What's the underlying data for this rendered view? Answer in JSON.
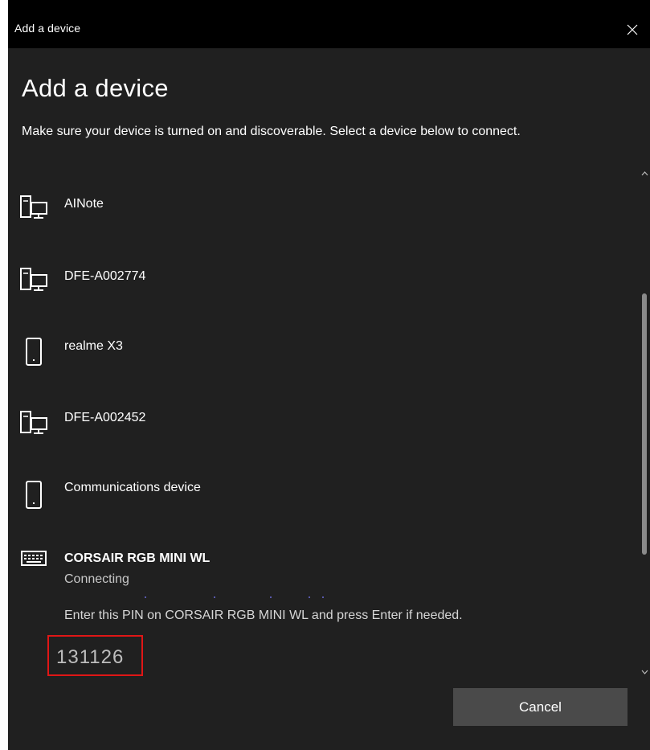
{
  "window": {
    "title": "Add a device",
    "heading": "Add a device",
    "instructions": "Make sure your device is turned on and discoverable. Select a device below to connect.",
    "colors": {
      "background": "#202020",
      "titlebar": "#000000",
      "highlight_border": "#e01616",
      "button": "#4a4a4a"
    }
  },
  "devices": [
    {
      "name": "AINote",
      "icon": "desktop-computer-icon"
    },
    {
      "name": "DFE-A002774",
      "icon": "desktop-computer-icon"
    },
    {
      "name": "realme X3",
      "icon": "phone-icon"
    },
    {
      "name": "DFE-A002452",
      "icon": "desktop-computer-icon"
    },
    {
      "name": "Communications device",
      "icon": "phone-icon"
    },
    {
      "name": "CORSAIR RGB MINI WL",
      "icon": "keyboard-icon",
      "status": "Connecting",
      "pin_instruction": "Enter this PIN on CORSAIR RGB MINI WL and press Enter if needed.",
      "pin": "131126"
    }
  ],
  "buttons": {
    "cancel": "Cancel"
  }
}
